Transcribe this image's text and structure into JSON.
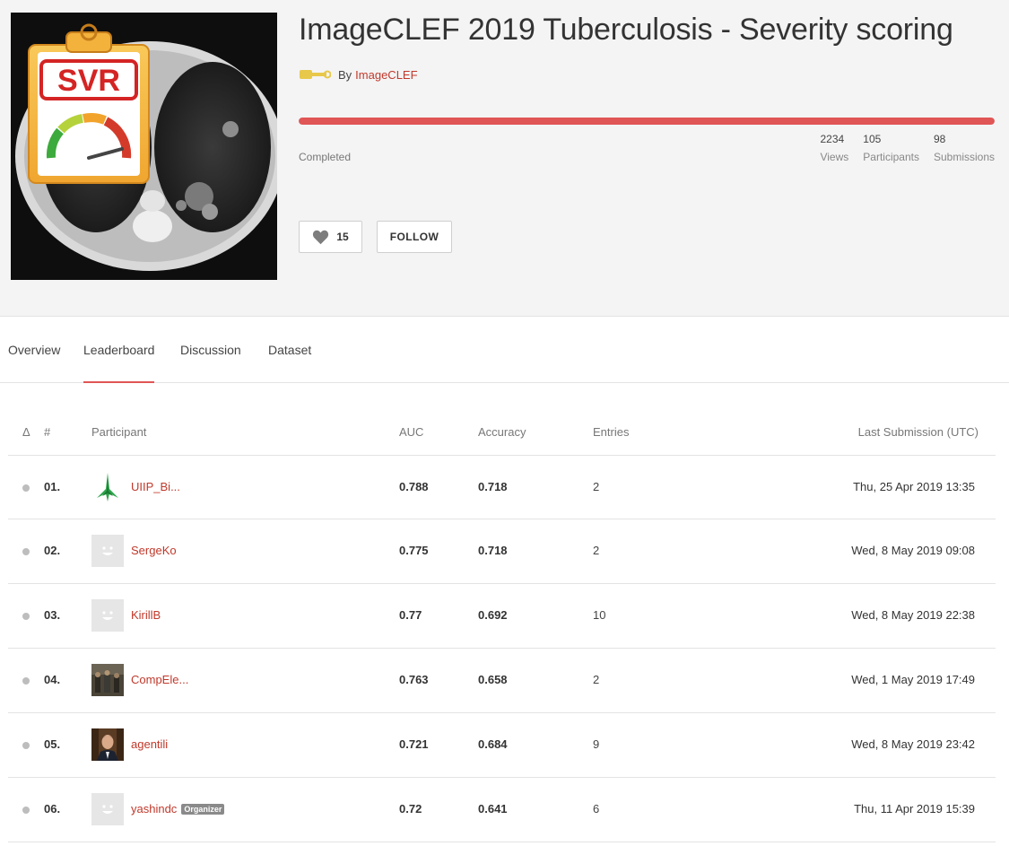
{
  "challenge": {
    "title": "ImageCLEF 2019 Tuberculosis - Severity scoring",
    "by_prefix": "By",
    "organizer": "ImageCLEF",
    "image_label": "SVR",
    "status": "Completed",
    "progress_fraction": 1.0,
    "stats": [
      {
        "value": "2234",
        "label": "Views"
      },
      {
        "value": "105",
        "label": "Participants"
      },
      {
        "value": "98",
        "label": "Submissions"
      }
    ],
    "like_count": "15",
    "follow_label": "FOLLOW"
  },
  "tabs": [
    {
      "label": "Overview",
      "active": false
    },
    {
      "label": "Leaderboard",
      "active": true
    },
    {
      "label": "Discussion",
      "active": false
    },
    {
      "label": "Dataset",
      "active": false
    }
  ],
  "leaderboard": {
    "headers": {
      "delta": "Δ",
      "rank": "#",
      "participant": "Participant",
      "auc": "AUC",
      "accuracy": "Accuracy",
      "entries": "Entries",
      "last_submission": "Last Submission (UTC)"
    },
    "rows": [
      {
        "rank": "01.",
        "participant": "UIIP_Bi...",
        "avatar": "green-logo",
        "badge": "",
        "auc": "0.788",
        "accuracy": "0.718",
        "entries": "2",
        "last": "Thu, 25 Apr 2019 13:35"
      },
      {
        "rank": "02.",
        "participant": "SergeKo",
        "avatar": "default",
        "badge": "",
        "auc": "0.775",
        "accuracy": "0.718",
        "entries": "2",
        "last": "Wed, 8 May 2019 09:08"
      },
      {
        "rank": "03.",
        "participant": "KirillB",
        "avatar": "default",
        "badge": "",
        "auc": "0.77",
        "accuracy": "0.692",
        "entries": "10",
        "last": "Wed, 8 May 2019 22:38"
      },
      {
        "rank": "04.",
        "participant": "CompEle...",
        "avatar": "photo-group",
        "badge": "",
        "auc": "0.763",
        "accuracy": "0.658",
        "entries": "2",
        "last": "Wed, 1 May 2019 17:49"
      },
      {
        "rank": "05.",
        "participant": "agentili",
        "avatar": "photo-portrait",
        "badge": "",
        "auc": "0.721",
        "accuracy": "0.684",
        "entries": "9",
        "last": "Wed, 8 May 2019 23:42"
      },
      {
        "rank": "06.",
        "participant": "yashindc",
        "avatar": "default",
        "badge": "Organizer",
        "auc": "0.72",
        "accuracy": "0.641",
        "entries": "6",
        "last": "Thu, 11 Apr 2019 15:39"
      }
    ]
  },
  "colors": {
    "accent": "#e05555",
    "link": "#c0392b",
    "header_bg": "#f4f4f4"
  }
}
